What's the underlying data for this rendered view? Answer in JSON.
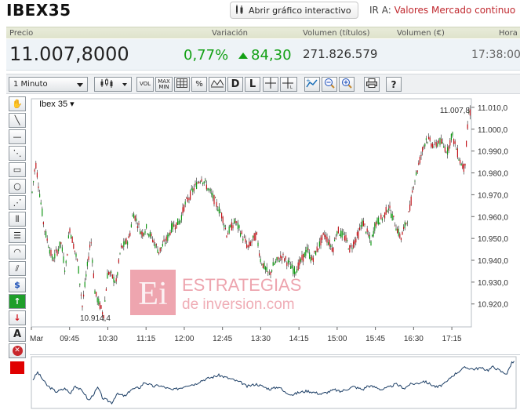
{
  "header": {
    "title": "IBEX35",
    "interactive_button": "Abrir gráfico interactivo",
    "goto_label": "IR A:",
    "goto_link": "Valores Mercado continuo"
  },
  "quote": {
    "columns": [
      "Precio",
      "Variación",
      "Volumen (títulos)",
      "Volumen (€)",
      "Hora"
    ],
    "price": "11.007,8000",
    "change_pct": "0,77%",
    "change_pts": "84,30",
    "volume_titles": "271.826.579",
    "time": "17:38:00",
    "positive_color": "#12a014"
  },
  "toolbar": {
    "interval": "1 Minuto",
    "buttons": [
      "VOL",
      "MAX MIN",
      "D",
      "L"
    ],
    "icons": [
      "candlestick-icon",
      "grid-icon",
      "percent-icon",
      "compare-icon",
      "crosshair-icon",
      "crosshair-label-icon",
      "indicators-icon",
      "zoom-out-icon",
      "zoom-in-icon",
      "print-icon",
      "help-icon"
    ]
  },
  "left_tools": [
    "hand-icon",
    "line-icon",
    "horizontal-line-icon",
    "channel-icon",
    "rectangle-icon",
    "circle-icon",
    "fan-icon",
    "fibonacci-vertical-icon",
    "fibonacci-horizontal-icon",
    "arc-icon",
    "parallel-icon",
    "dollar-icon",
    "buy-arrow-icon",
    "sell-arrow-icon",
    "text-icon",
    "delete-icon",
    "color-icon"
  ],
  "watermark": {
    "line1": "ESTRATEGIAS",
    "line2": "de inversion.com",
    "logo": "Ei"
  },
  "chart_data": {
    "type": "line",
    "title": "Ibex 35",
    "last_label": "11.007,8",
    "min_label": "10.914,4",
    "x_ticks": [
      "Mar",
      "09:45",
      "10:30",
      "11:15",
      "12:00",
      "12:45",
      "13:30",
      "14:15",
      "15:00",
      "15:45",
      "16:30",
      "17:15"
    ],
    "y_ticks": [
      "11.010,0",
      "11.000,0",
      "10.990,0",
      "10.980,0",
      "10.970,0",
      "10.960,0",
      "10.950,0",
      "10.940,0",
      "10.930,0",
      "10.920,0"
    ],
    "ylim": [
      10909.5,
      11012.5
    ],
    "x": [
      "09:00",
      "09:05",
      "09:15",
      "09:25",
      "09:35",
      "09:40",
      "09:45",
      "09:55",
      "10:00",
      "10:10",
      "10:15",
      "10:25",
      "10:30",
      "10:40",
      "10:45",
      "10:55",
      "11:00",
      "11:10",
      "11:15",
      "11:25",
      "11:30",
      "11:40",
      "11:45",
      "11:55",
      "12:00",
      "12:10",
      "12:20",
      "12:25",
      "12:35",
      "12:45",
      "12:50",
      "13:00",
      "13:10",
      "13:15",
      "13:25",
      "13:30",
      "13:40",
      "13:45",
      "13:55",
      "14:00",
      "14:10",
      "14:15",
      "14:25",
      "14:30",
      "14:40",
      "14:45",
      "14:55",
      "15:00",
      "15:10",
      "15:15",
      "15:25",
      "15:30",
      "15:40",
      "15:45",
      "15:55",
      "16:00",
      "16:10",
      "16:15",
      "16:25",
      "16:30",
      "16:40",
      "16:45",
      "16:55",
      "17:00",
      "17:10",
      "17:15",
      "17:25",
      "17:30",
      "17:35"
    ],
    "y": [
      10968,
      10985,
      10955,
      10940,
      10948,
      10935,
      10955,
      10938,
      10919,
      10950,
      10925,
      10915,
      10935,
      10930,
      10945,
      10950,
      10962,
      10952,
      10955,
      10948,
      10944,
      10950,
      10955,
      10958,
      10965,
      10972,
      10978,
      10975,
      10968,
      10960,
      10952,
      10958,
      10950,
      10946,
      10952,
      10940,
      10933,
      10938,
      10942,
      10940,
      10935,
      10938,
      10945,
      10940,
      10948,
      10952,
      10945,
      10954,
      10950,
      10945,
      10952,
      10958,
      10948,
      10957,
      10960,
      10965,
      10955,
      10950,
      10962,
      10975,
      10990,
      10996,
      10992,
      10995,
      10990,
      10998,
      10985,
      10982,
      11007.8
    ]
  }
}
